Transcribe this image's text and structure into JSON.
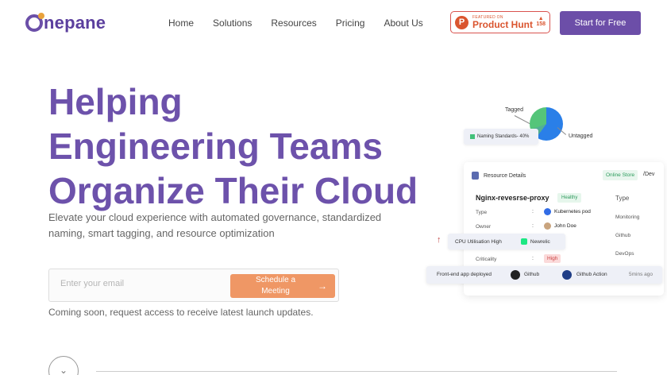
{
  "brand": {
    "name": "nepane"
  },
  "nav": {
    "items": [
      "Home",
      "Solutions",
      "Resources",
      "Pricing",
      "About Us"
    ]
  },
  "product_hunt": {
    "featured": "FEATURED ON",
    "name": "Product Hunt",
    "votes": "158",
    "arrow": "▲",
    "logo_letter": "P"
  },
  "header_cta": "Start for Free",
  "hero": {
    "title_lines": [
      "Helping",
      "Engineering Teams",
      "Organize Their Cloud"
    ],
    "subtitle": "Elevate your cloud experience with automated governance, standardized naming, smart tagging, and resource optimization",
    "email_placeholder": "Enter your email",
    "schedule_label": "Schedule a Meeting",
    "schedule_arrow": "→",
    "note": "Coming soon, request access to receive latest launch updates.",
    "scroll_icon": "⌄"
  },
  "illustration": {
    "tagged": "Tagged",
    "untagged": "Untagged",
    "naming": "Naming Standards- 40%",
    "resource_details": "Resource Details",
    "env_chip": "Online Store",
    "env_path": "/Dev",
    "resource_name": "Nginx-revesrse-proxy",
    "health": "Healthy",
    "rows": [
      {
        "label": "Type",
        "value": "Kubernetes pod"
      },
      {
        "label": "Owner",
        "value": "John Doe"
      },
      {
        "label": "Criticality",
        "value": "High"
      }
    ],
    "side_col": [
      "Type",
      "Monitoring",
      "Github",
      "DevOps"
    ],
    "cpu": {
      "label": "CPU Utilisation High",
      "tool": "Newrelic"
    },
    "deploy": {
      "label": "Front-end app deployed",
      "tool1": "Github",
      "tool2": "Github Action",
      "time": "5mins ago"
    },
    "colon": ":",
    "up_arrow": "↑"
  },
  "colors": {
    "brand_purple": "#6d52ab",
    "cta_purple": "#6c4ea8",
    "schedule_orange": "#ef9765",
    "ph_orange": "#da552f"
  }
}
